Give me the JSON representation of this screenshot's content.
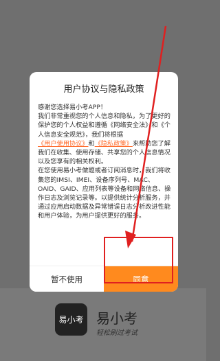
{
  "dialog": {
    "title": "用户协议与隐私政策",
    "body": {
      "p1": "感谢您选择易小考APP！",
      "p2_a": "我们非常重视您的个人信息和隐私，为了更好的保护您的个人权益和遵循《网络安全法》和《个人信息安全规范》，我们将根据",
      "link_user": "《用户使用协议》",
      "p2_and": "和",
      "link_privacy": "《隐私政策》",
      "p2_b": "来帮助您了解我们在收集、使用存储、共享您的个人信息情况以及您享有的相关权利。",
      "p3": "在您使用易小考做题或者订阅消息时，我们将收集您的IMSI、IMEI、设备序列号、MAC、OAID、GAID、应用列表等设备和网络信息、操作日志及浏览记录等。以提供统计分析服务，并通过应用启动数据及异常错误日志分析改进性能和用户体验，为用户提供更好的服务。"
    },
    "decline_label": "暂不使用",
    "agree_label": "同意"
  },
  "brand": {
    "logo_text": "易小考",
    "app_name": "易小考",
    "slogan": "轻松刷过考试"
  },
  "colors": {
    "accent": "#ff8a1e",
    "link": "#ff6a2a",
    "annotation": "#e02020"
  }
}
